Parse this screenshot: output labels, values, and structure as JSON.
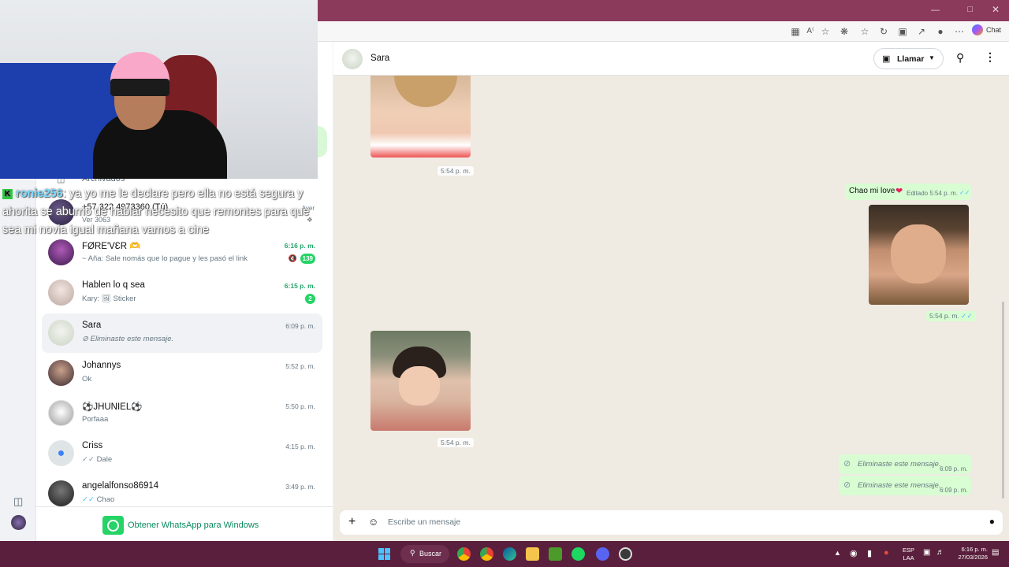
{
  "browser": {
    "chat_label": "Chat"
  },
  "stream_overlay": {
    "username": "ronie256",
    "message": ": ya yo me le declare pero ella no está segura y ahorita se aburrio de hablar necesito que remontes para que sea mi novia igual mañana vamos a cine"
  },
  "chat_list": {
    "partial_archived": "Archivados",
    "partial_phone": "+57 322 4973360 (Tú)",
    "partial_sub": "Ver 3063",
    "partial_time": "Ayer",
    "items": [
      {
        "name": "FØRE'VƐR 🫶",
        "preview": "~ Aña: Sale nomás que lo pague y les pasó el link",
        "time": "6:16 p. m.",
        "badge": "139"
      },
      {
        "name": "Hablen lo q sea",
        "preview": "Kary: 🖼 Sticker",
        "time": "6:15 p. m.",
        "badge": "2"
      },
      {
        "name": "Sara",
        "preview": "Eliminaste este mensaje.",
        "time": "6:09 p. m."
      },
      {
        "name": "Johannys",
        "preview": "Ok",
        "time": "5:52 p. m."
      },
      {
        "name": "⚽JHUNIEL⚽",
        "preview": "Porfaaa",
        "time": "5:50 p. m."
      },
      {
        "name": "Criss",
        "preview": "Dale",
        "time": "4:15 p. m."
      },
      {
        "name": "angelalfonso86914",
        "preview": "Chao",
        "time": "3:49 p. m."
      }
    ],
    "get_whatsapp": "Obtener WhatsApp para Windows"
  },
  "conversation": {
    "contact_name": "Sara",
    "call_label": "Llamar",
    "messages": {
      "img1_time": "5:54 p. m.",
      "text_msg": "Chao mi love",
      "text_edited": "Editado 5:54 p. m.",
      "img2_time": "5:54 p. m.",
      "img3_time": "5:54 p. m.",
      "deleted1": "Eliminaste este mensaje.",
      "deleted1_time": "6:09 p. m.",
      "deleted2": "Eliminaste este mensaje.",
      "deleted2_time": "6:09 p. m."
    },
    "composer_placeholder": "Escribe un mensaje"
  },
  "taskbar": {
    "search_label": "Buscar",
    "lang_top": "ESP",
    "lang_bottom": "LAA",
    "time": "6:16 p. m.",
    "date": "27/03/2026"
  },
  "colors": {
    "whatsapp_green": "#25d366",
    "outgoing_bubble": "#d9fdd3",
    "title_bar": "#8c3a5c",
    "taskbar": "#5a1f3c"
  }
}
